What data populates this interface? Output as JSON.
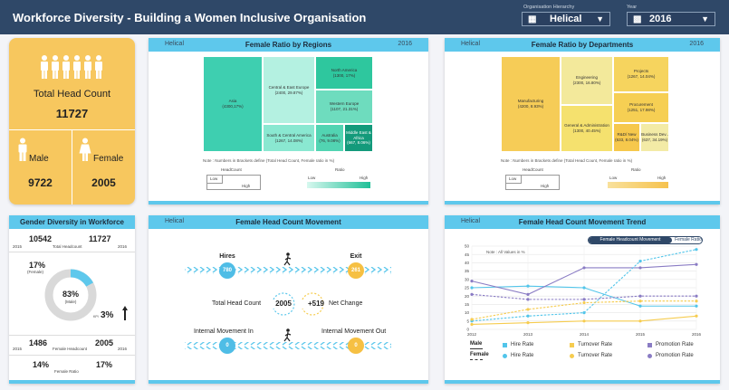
{
  "header": {
    "title": "Workforce Diversity - Building a Women Inclusive Organisation",
    "hierarchy_label": "Organisation Hierarchy",
    "hierarchy_value": "Helical",
    "year_label": "Year",
    "year_value": "2016"
  },
  "summary": {
    "total_label": "Total Head Count",
    "total_value": "11727",
    "male_label": "Male",
    "male_value": "9722",
    "female_label": "Female",
    "female_value": "2005",
    "bg_color": "#f7c75e"
  },
  "regions": {
    "left": "Helical",
    "title": "Female Ratio by Regions",
    "right": "2016",
    "cells": [
      {
        "name": "Asia",
        "value": "(4300,17%)"
      },
      {
        "name": "Central & East Europe",
        "value": "(2400, 29.87%)"
      },
      {
        "name": "South & Central America",
        "value": "(1267, 14.08%)"
      },
      {
        "name": "North America",
        "value": "(1300, 17%)"
      },
      {
        "name": "Western Europe",
        "value": "(1107, 21.31%)"
      },
      {
        "name": "Australia",
        "value": "(76, 9.08%)"
      },
      {
        "name": "Middle East & Africa",
        "value": "(667, 8.06%)"
      }
    ],
    "note": "Note : Numbers in Brackets define (Total Head Count, Female ratio in %)",
    "headcount_label": "HeadCount",
    "ratio_label": "Ratio",
    "low": "Low",
    "high": "High"
  },
  "departments": {
    "left": "Helical",
    "title": "Female Ratio by Departments",
    "right": "2016",
    "cells": [
      {
        "name": "Manufacturing",
        "value": "(4200, 8.93%)"
      },
      {
        "name": "Engineering",
        "value": "(2300, 16.80%)"
      },
      {
        "name": "General & Administration",
        "value": "(1300, 40.45%)"
      },
      {
        "name": "Projects",
        "value": "(1267, 14.04%)"
      },
      {
        "name": "Procurement",
        "value": "(1251, 17.98%)"
      },
      {
        "name": "R&D/ New",
        "value": "(633, 8.04%)"
      },
      {
        "name": "Business Dev..",
        "value": "(637, 34.19%)"
      }
    ],
    "note": "Note : Numbers in Brackets define (Total Head Count, Female ratio in %)",
    "headcount_label": "HeadCount",
    "ratio_label": "Ratio",
    "low": "Low",
    "high": "High"
  },
  "gender": {
    "title": "Gender Diversity in Workforce",
    "hc2015": "10542",
    "hc2016": "11727",
    "year2015": "2015",
    "hc_label": "Total Headcount",
    "year2016": "2016",
    "female_pct": "17%",
    "female_label": "(Female)",
    "male_pct": "83%",
    "male_label": "(Male)",
    "kpi_label": "KPI",
    "kpi_value": "3%",
    "fh2015": "1486",
    "fh2016": "2005",
    "fh_label": "Female Headcount",
    "fr2015": "14%",
    "fr2016": "17%",
    "fr_label": "Female Ratio",
    "female_fraction": 0.17
  },
  "movement": {
    "left": "Helical",
    "title": "Female Head Count Movement",
    "hires_label": "Hires",
    "hires_value": "780",
    "exit_label": "Exit",
    "exit_value": "261",
    "total_label": "Total Head Count",
    "total_value": "2005",
    "net_label": "Net Change",
    "net_value": "+519",
    "in_label": "Internal Movement In",
    "in_value": "0",
    "out_label": "Internal Movement Out",
    "out_value": "0"
  },
  "trend": {
    "left": "Helical",
    "title": "Female Head Count Movement Trend",
    "legend_headcount": "Female Headcount Movement",
    "legend_ratio": "Female Ratio",
    "note": "Note : All Values in %",
    "male_label": "Male",
    "female_label": "Female",
    "series_labels": [
      "Hire Rate",
      "Turnover Rate",
      "Promotion Rate",
      "Hire Rate",
      "Turnover Rate",
      "Promotion Rate"
    ]
  },
  "chart_data": {
    "type": "line",
    "title": "Female Head Count Movement Trend",
    "x": [
      2012,
      2013,
      2014,
      2015,
      2016
    ],
    "ylim": [
      0,
      50
    ],
    "yticks": [
      0,
      5,
      10,
      15,
      20,
      25,
      30,
      35,
      40,
      45,
      50
    ],
    "series": [
      {
        "name": "Hire Rate",
        "group": "Male",
        "color": "#52c5ea",
        "dashed": false,
        "values": [
          25,
          26,
          25,
          14,
          14
        ]
      },
      {
        "name": "Turnover Rate",
        "group": "Male",
        "color": "#f6cc4f",
        "dashed": false,
        "values": [
          3,
          4,
          5,
          5,
          8
        ]
      },
      {
        "name": "Promotion Rate",
        "group": "Male",
        "color": "#8a7cc4",
        "dashed": false,
        "values": [
          29,
          21,
          37,
          37,
          39
        ]
      },
      {
        "name": "Hire Rate",
        "group": "Female",
        "color": "#52c5ea",
        "dashed": true,
        "values": [
          5,
          8,
          10,
          41,
          48
        ]
      },
      {
        "name": "Turnover Rate",
        "group": "Female",
        "color": "#f6cc4f",
        "dashed": true,
        "values": [
          6,
          12,
          16,
          17,
          17
        ]
      },
      {
        "name": "Promotion Rate",
        "group": "Female",
        "color": "#8a7cc4",
        "dashed": true,
        "values": [
          21,
          18,
          18,
          20,
          20
        ]
      }
    ]
  }
}
